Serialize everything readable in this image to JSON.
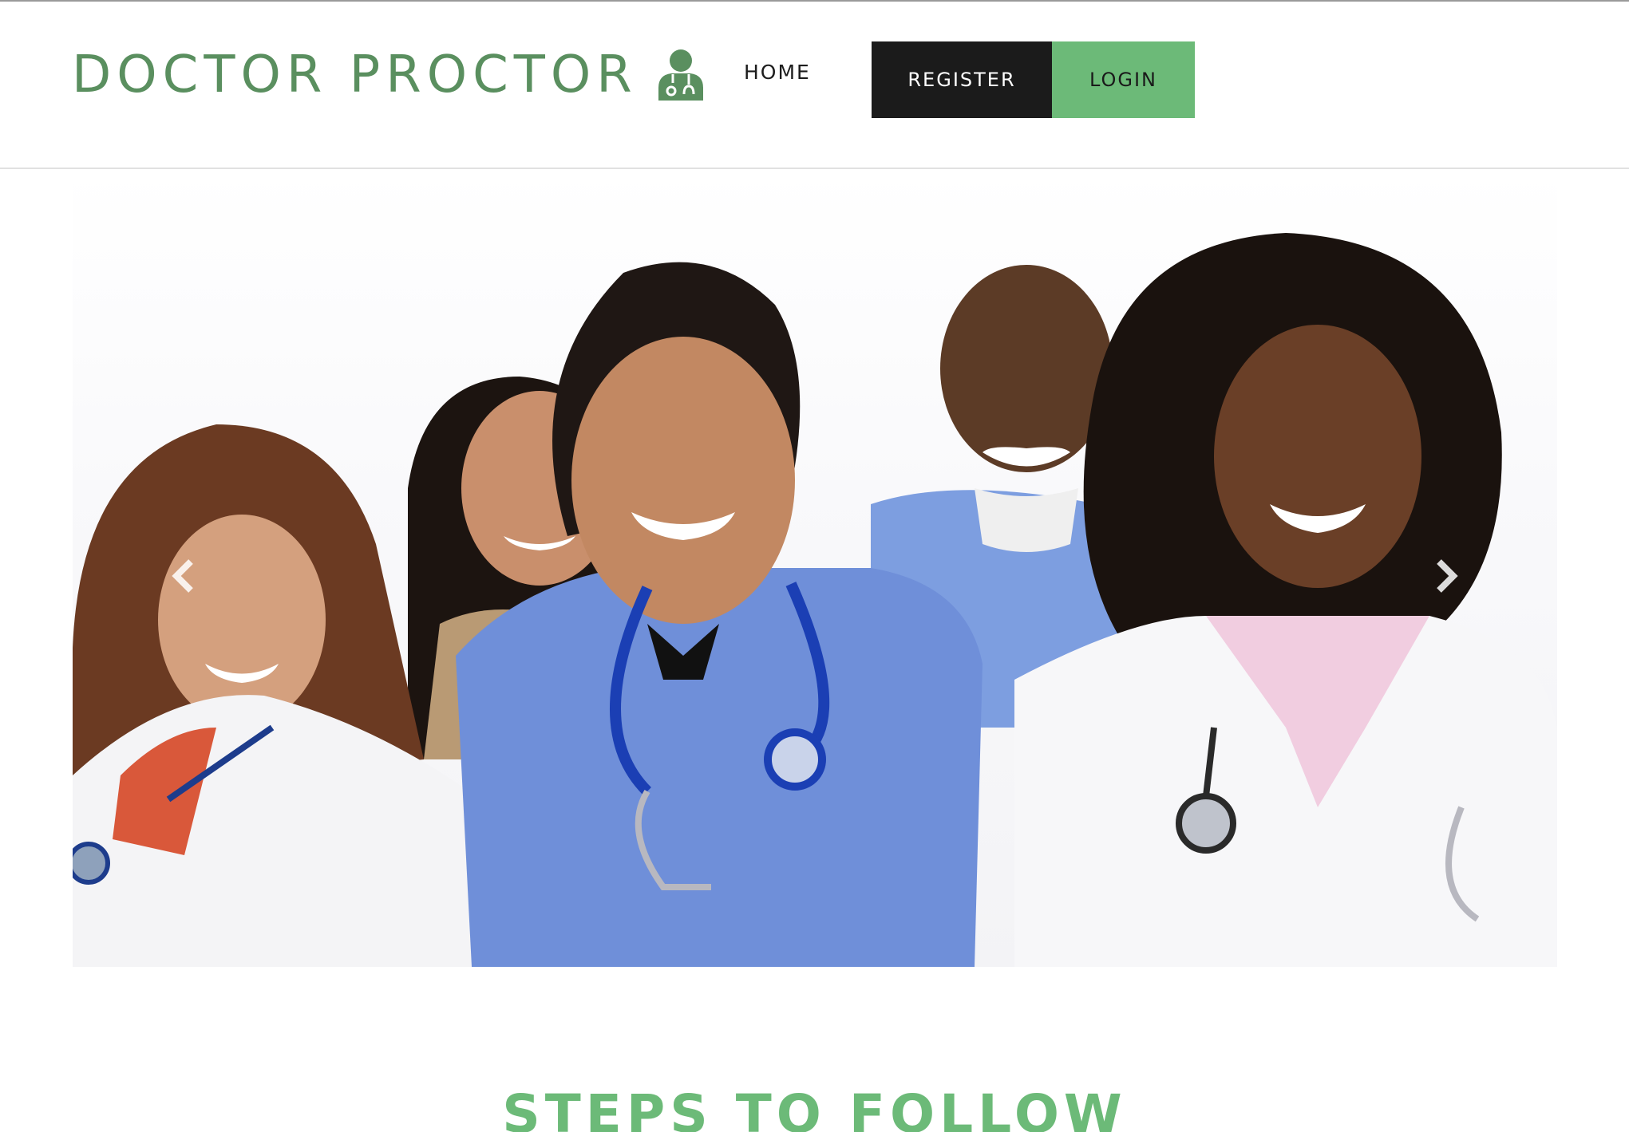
{
  "header": {
    "brand_name": "DOCTOR PROCTOR",
    "brand_icon": "doctor-stethoscope-icon",
    "nav": {
      "home_label": "HOME"
    },
    "register_label": "REGISTER",
    "login_label": "LOGIN"
  },
  "hero": {
    "image": "group-of-smiling-doctors-photo",
    "prev_icon": "chevron-left-icon",
    "next_icon": "chevron-right-icon"
  },
  "section": {
    "title": "STEPS TO FOLLOW"
  },
  "colors": {
    "brand_green": "#5a8f5f",
    "accent_green": "#6cba78",
    "dark_button": "#1b1b1b",
    "scrub_blue": "#6f8fd9"
  }
}
